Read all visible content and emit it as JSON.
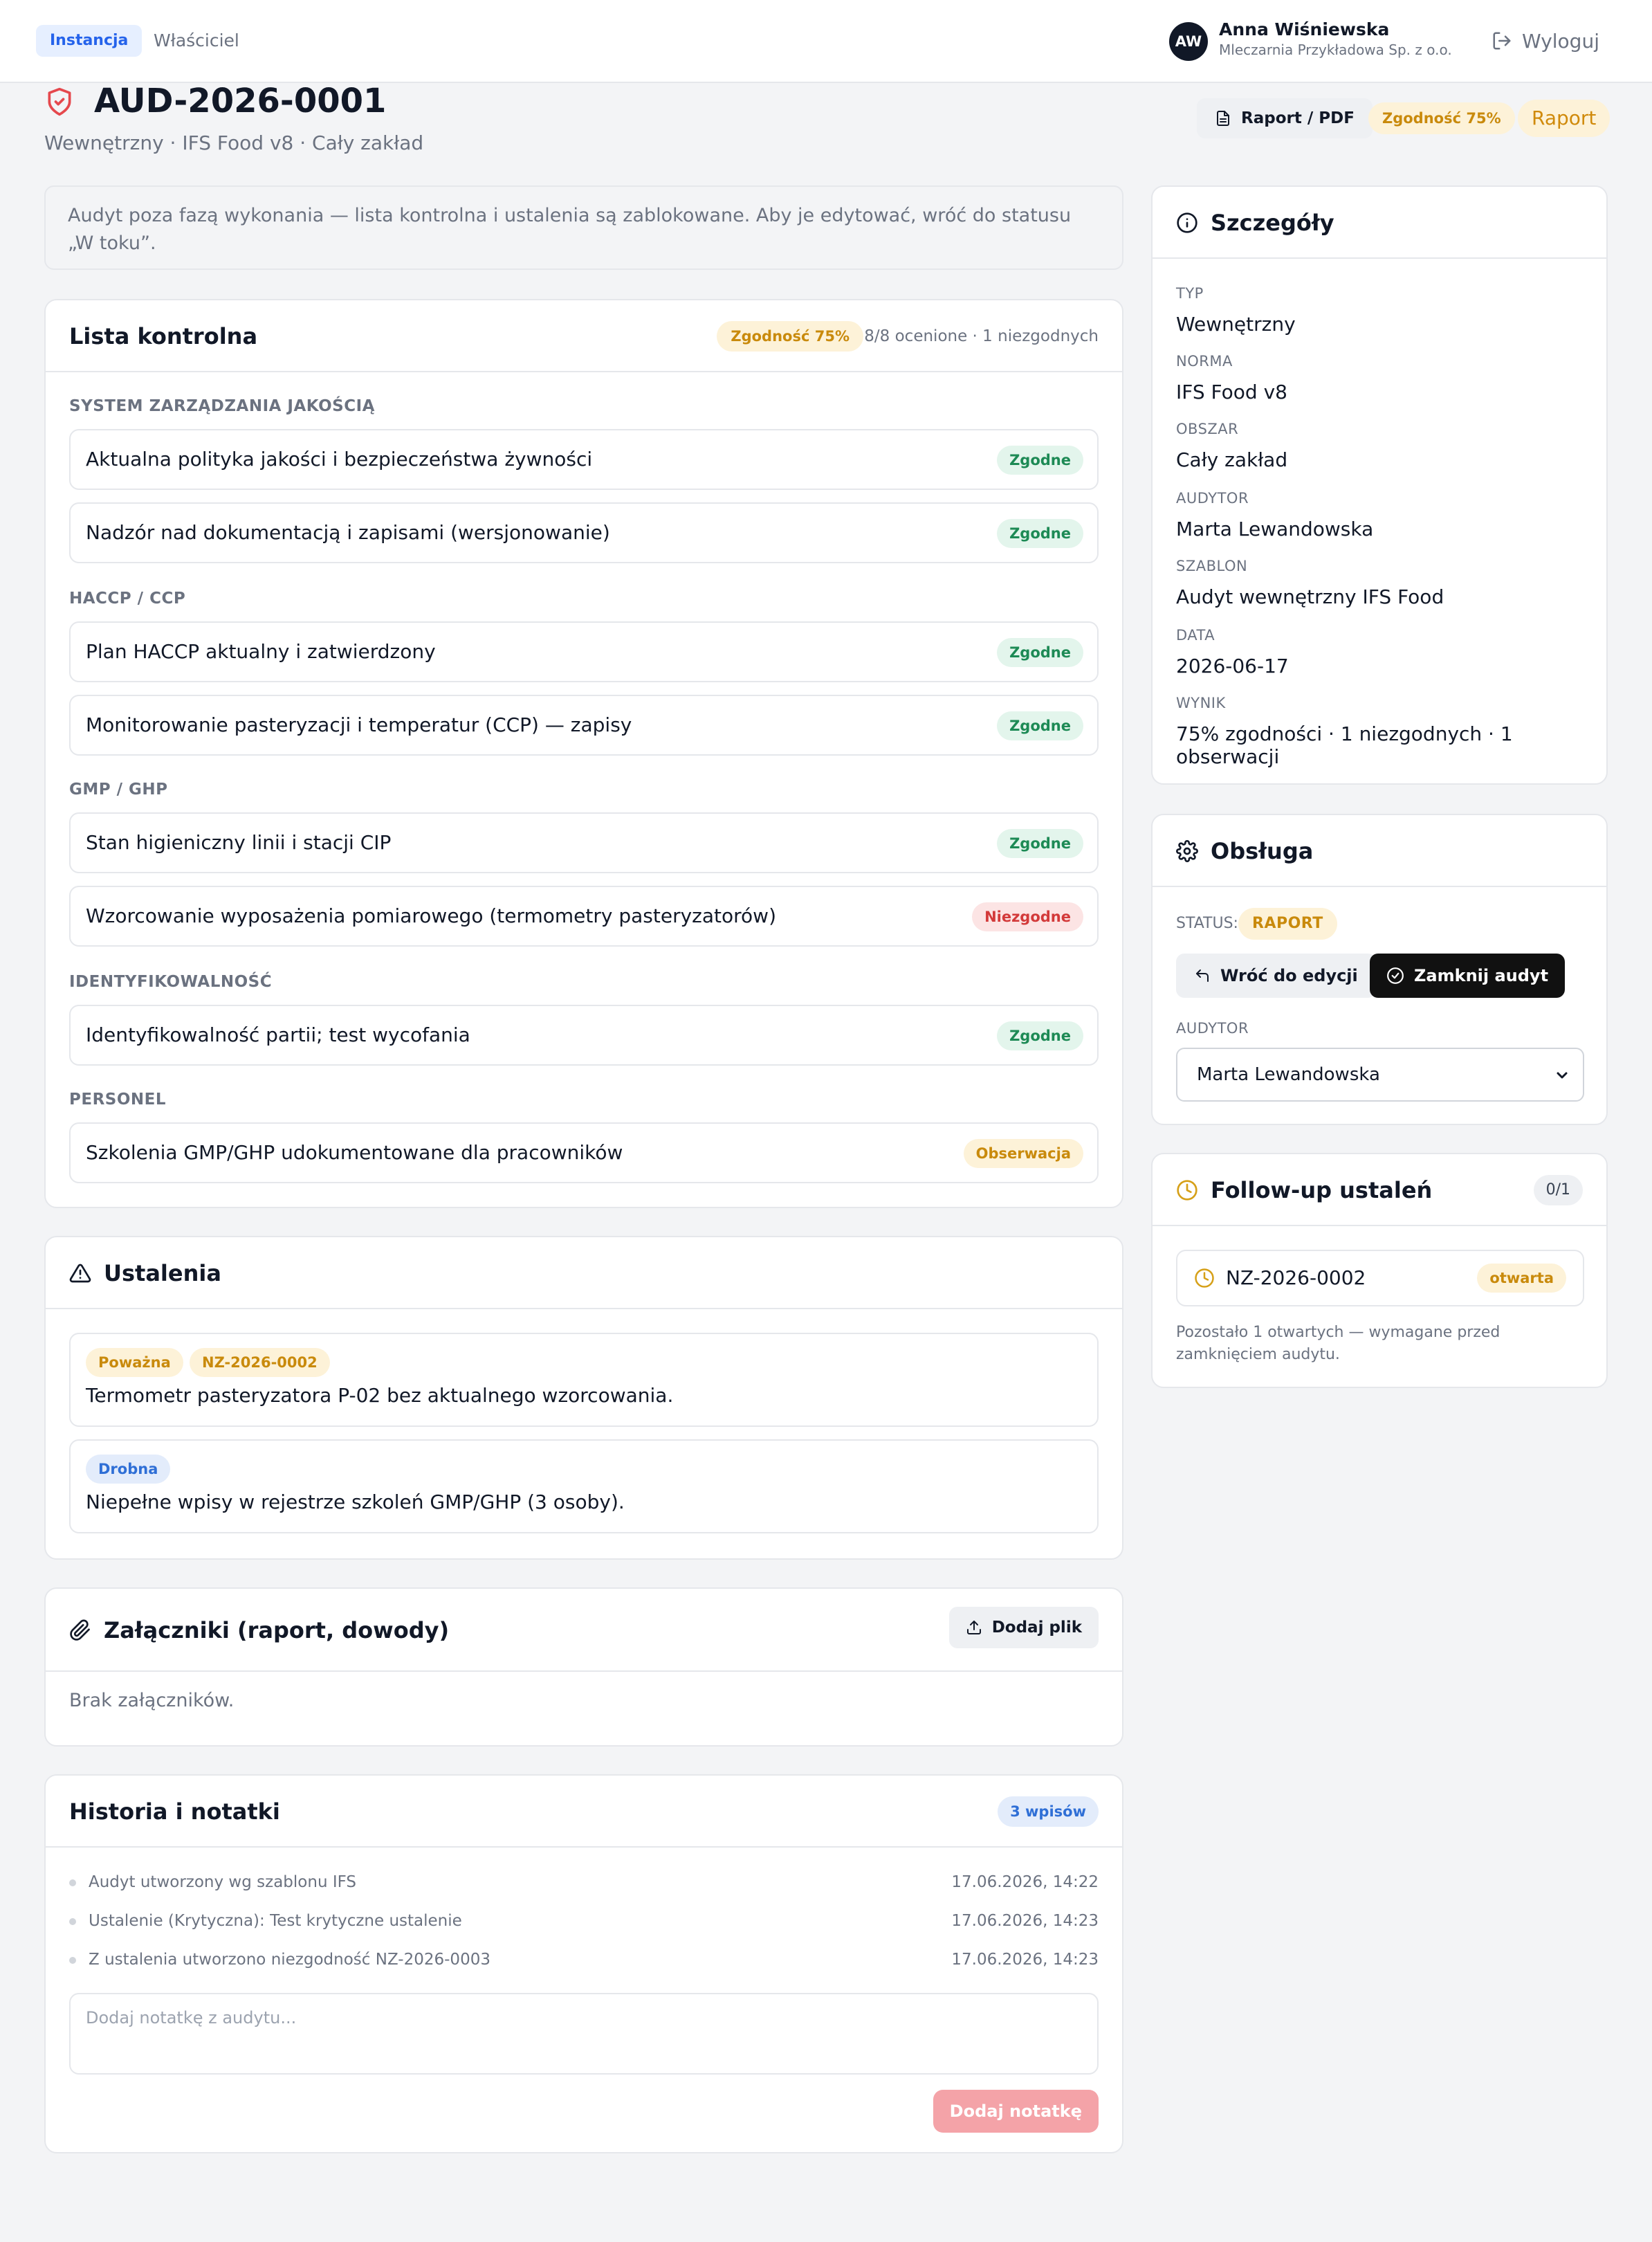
{
  "topbar": {
    "tabs": [
      "Instancja",
      "Właściciel"
    ],
    "user": {
      "initials": "AW",
      "name": "Anna Wiśniewska",
      "org": "Mleczarnia Przykładowa Sp. z o.o."
    },
    "logout_label": "Wyloguj"
  },
  "header": {
    "title": "AUD-2026-0001",
    "subtitle": "Wewnętrzny · IFS Food v8 · Cały zakład",
    "pdf_button": "Raport / PDF",
    "compliance_badge": "Zgodność 75%",
    "status_badge": "Raport"
  },
  "banner": "Audyt poza fazą wykonania — lista kontrolna i ustalenia są zablokowane. Aby je edytować, wróć do statusu „W toku”.",
  "checklist": {
    "title": "Lista kontrolna",
    "compliance_badge": "Zgodność 75%",
    "meta": "8/8 ocenione · 1 niezgodnych",
    "sections": [
      {
        "label": "SYSTEM ZARZĄDZANIA JAKOŚCIĄ",
        "items": [
          {
            "text": "Aktualna polityka jakości i bezpieczeństwa żywności",
            "status": "Zgodne"
          },
          {
            "text": "Nadzór nad dokumentacją i zapisami (wersjonowanie)",
            "status": "Zgodne"
          }
        ]
      },
      {
        "label": "HACCP / CCP",
        "items": [
          {
            "text": "Plan HACCP aktualny i zatwierdzony",
            "status": "Zgodne"
          },
          {
            "text": "Monitorowanie pasteryzacji i temperatur (CCP) — zapisy",
            "status": "Zgodne"
          }
        ]
      },
      {
        "label": "GMP / GHP",
        "items": [
          {
            "text": "Stan higieniczny linii i stacji CIP",
            "status": "Zgodne"
          },
          {
            "text": "Wzorcowanie wyposażenia pomiarowego (termometry pasteryzatorów)",
            "status": "Niezgodne"
          }
        ]
      },
      {
        "label": "IDENTYFIKOWALNOŚĆ",
        "items": [
          {
            "text": "Identyfikowalność partii; test wycofania",
            "status": "Zgodne"
          }
        ]
      },
      {
        "label": "PERSONEL",
        "items": [
          {
            "text": "Szkolenia GMP/GHP udokumentowane dla pracowników",
            "status": "Obserwacja"
          }
        ]
      }
    ]
  },
  "findings": {
    "title": "Ustalenia",
    "items": [
      {
        "severity": "Poważna",
        "ref": "NZ-2026-0002",
        "text": "Termometr pasteryzatora P-02 bez aktualnego wzorcowania."
      },
      {
        "severity": "Drobna",
        "text": "Niepełne wpisy w rejestrze szkoleń GMP/GHP (3 osoby)."
      }
    ]
  },
  "attachments": {
    "title": "Załączniki (raport, dowody)",
    "add_button": "Dodaj plik",
    "empty": "Brak załączników."
  },
  "history": {
    "title": "Historia i notatki",
    "badge": "3 wpisów",
    "entries": [
      {
        "text": "Audyt utworzony wg szablonu IFS",
        "date": "17.06.2026, 14:22"
      },
      {
        "text": "Ustalenie (Krytyczna): Test krytyczne ustalenie",
        "date": "17.06.2026, 14:23"
      },
      {
        "text": "Z ustalenia utworzono niezgodność NZ-2026-0003",
        "date": "17.06.2026, 14:23"
      }
    ],
    "note_placeholder": "Dodaj notatkę z audytu...",
    "add_note_button": "Dodaj notatkę"
  },
  "details": {
    "title": "Szczegóły",
    "fields": [
      {
        "label": "TYP",
        "value": "Wewnętrzny"
      },
      {
        "label": "NORMA",
        "value": "IFS Food v8"
      },
      {
        "label": "OBSZAR",
        "value": "Cały zakład"
      },
      {
        "label": "AUDYTOR",
        "value": "Marta Lewandowska"
      },
      {
        "label": "SZABLON",
        "value": "Audyt wewnętrzny IFS Food"
      },
      {
        "label": "DATA",
        "value": "2026-06-17"
      },
      {
        "label": "WYNIK",
        "value": "75% zgodności · 1 niezgodnych · 1 obserwacji"
      }
    ]
  },
  "service": {
    "title": "Obsługa",
    "status_label": "STATUS:",
    "status_value": "RAPORT",
    "back_button": "Wróć do edycji",
    "close_button": "Zamknij audyt",
    "auditor_label": "AUDYTOR",
    "auditor_selected": "Marta Lewandowska"
  },
  "followup": {
    "title": "Follow-up ustaleń",
    "count": "0/1",
    "item": {
      "id": "NZ-2026-0002",
      "status": "otwarta"
    },
    "note": "Pozostało 1 otwartych — wymagane przed zamknięciem audytu."
  },
  "colors": {
    "accent_blue": "#2563eb",
    "danger_red": "#e5484d",
    "amber": "#c98a0c",
    "green": "#1d8a55"
  }
}
